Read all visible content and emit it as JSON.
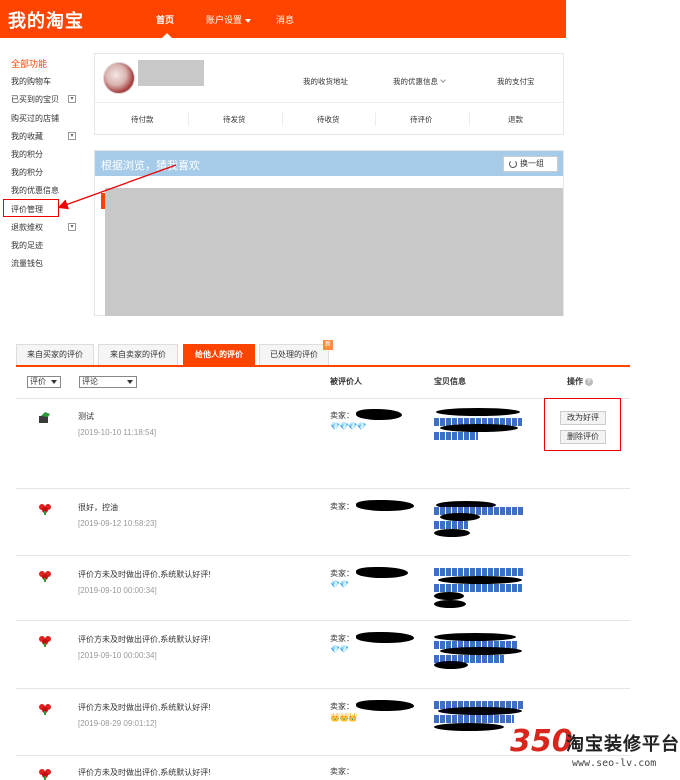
{
  "header": {
    "logo": "我的淘宝",
    "nav": [
      "首页",
      "账户设置",
      "消息"
    ]
  },
  "sidebar": {
    "items": [
      {
        "label": "全部功能",
        "plus": false
      },
      {
        "label": "我的购物车",
        "plus": false
      },
      {
        "label": "已买到的宝贝",
        "plus": true
      },
      {
        "label": "购买过的店铺",
        "plus": false
      },
      {
        "label": "我的收藏",
        "plus": true
      },
      {
        "label": "我的积分",
        "plus": false
      },
      {
        "label": "我的积分",
        "plus": false
      },
      {
        "label": "我的优惠信息",
        "plus": false
      },
      {
        "label": "评价管理",
        "plus": false
      },
      {
        "label": "退款维权",
        "plus": true
      },
      {
        "label": "我的足迹",
        "plus": false
      },
      {
        "label": "流量钱包",
        "plus": false
      }
    ]
  },
  "profile": {
    "links": [
      "我的收货地址",
      "我的优惠信息",
      "我的支付宝"
    ],
    "orders": [
      "待付款",
      "待发货",
      "待收货",
      "待评价",
      "退款"
    ]
  },
  "recommend": {
    "title": "根据浏览，猜我喜欢",
    "refresh": "换一组"
  },
  "tabs": [
    {
      "label": "来自买家的评价",
      "active": false
    },
    {
      "label": "来自卖家的评价",
      "active": false
    },
    {
      "label": "给他人的评价",
      "active": true
    },
    {
      "label": "已处理的评价",
      "active": false
    }
  ],
  "tab_badge": "新",
  "table": {
    "filter1": "评价",
    "filter2": "评论",
    "headers": {
      "rated": "被评价人",
      "item": "宝贝信息",
      "ops": "操作"
    },
    "help_icon": "?"
  },
  "rows": [
    {
      "icon": "face-icon",
      "comment": "测试",
      "date": "[2019-10-10 11:18:54]",
      "seller": "卖家：",
      "badges": "💎💎💎💎"
    },
    {
      "icon": "flower-icon",
      "comment": "很好，控油",
      "date": "[2019-09-12 10:58:23]",
      "seller": "卖家：",
      "badges": ""
    },
    {
      "icon": "flower-icon",
      "comment": "评价方未及时做出评价,系统默认好评!",
      "date": "[2019-09-10 00:00:34]",
      "seller": "卖家：",
      "badges": "💎💎"
    },
    {
      "icon": "flower-icon",
      "comment": "评价方未及时做出评价,系统默认好评!",
      "date": "[2019-09-10 00:00:34]",
      "seller": "卖家：",
      "badges": "💎💎"
    },
    {
      "icon": "flower-icon",
      "comment": "评价方未及时做出评价,系统默认好评!",
      "date": "[2019-08-29 09:01:12]",
      "seller": "卖家：",
      "badges": "👑👑👑"
    },
    {
      "icon": "flower-icon",
      "comment": "评价方未及时做出评价,系统默认好评!",
      "date": "",
      "seller": "卖家：",
      "badges": ""
    }
  ],
  "ops": {
    "change": "改为好评",
    "delete": "删除评价"
  },
  "watermark": {
    "num": "350",
    "text": "淘宝装修平台",
    "url": "www.seo-lv.com"
  },
  "colors": {
    "accent": "#ff4400",
    "highlight": "#e00000",
    "link": "#3d6fc4"
  }
}
